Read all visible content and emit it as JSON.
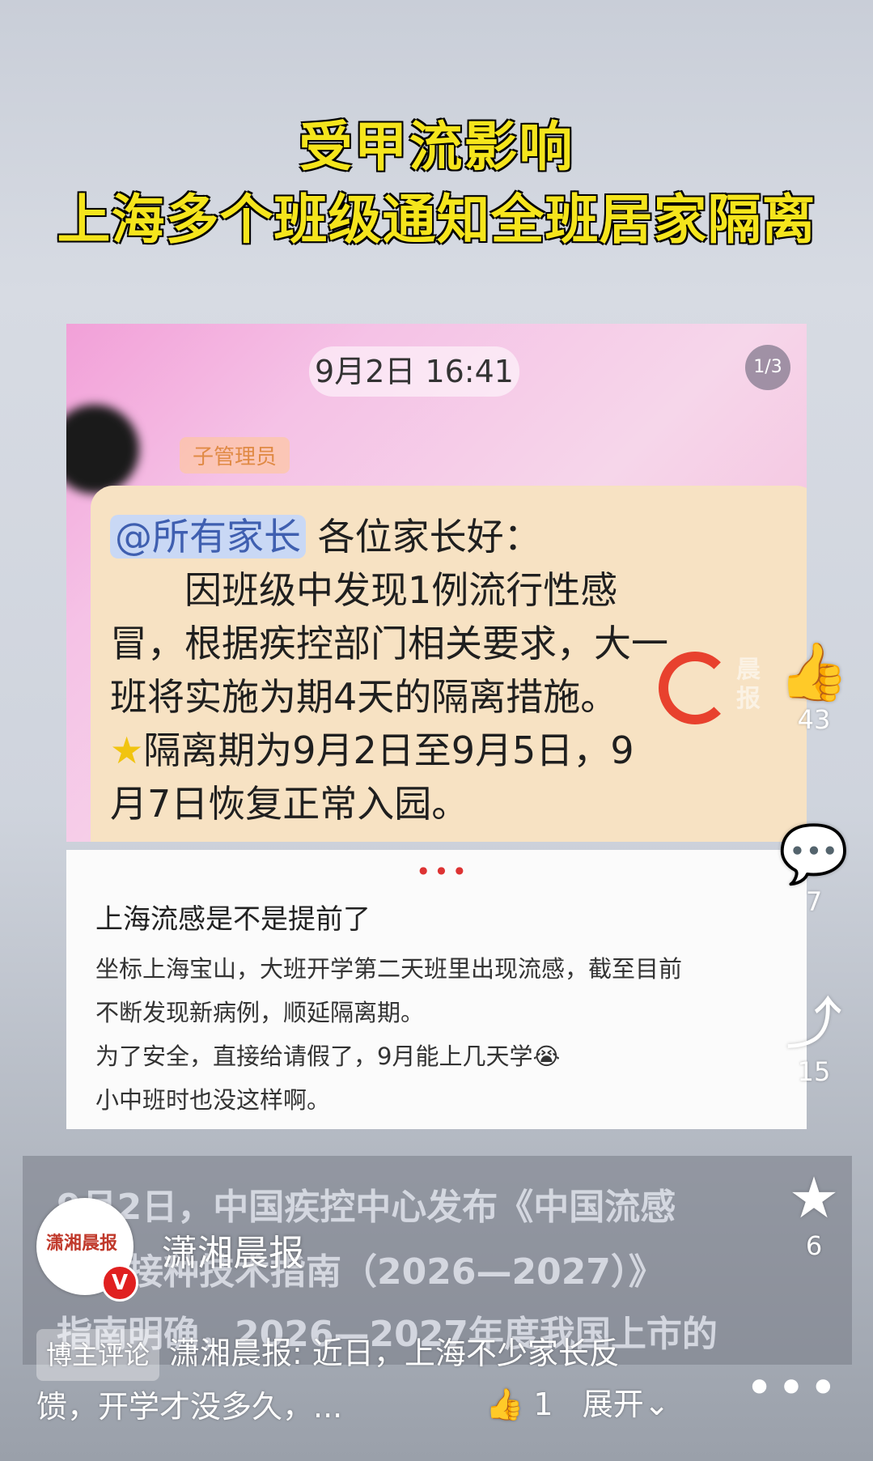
{
  "headline": {
    "line1": "受甲流影响",
    "line2": "上海多个班级通知全班居家隔离"
  },
  "chat_image": {
    "timestamp": "9月2日 16:41",
    "page_counter": "1/3",
    "admin_tag": "子管理员",
    "mention": "@所有家长",
    "greeting": "各位家长好：",
    "lines": [
      "因班级中发现1例流行性感",
      "冒，根据疾控部门相关要求，大一",
      "班将实施为期4天的隔离措施。",
      "隔离期为9月2日至9月5日，9",
      "月7日恢复正常入园。"
    ],
    "star_icon": "star-emoji"
  },
  "post": {
    "title": "上海流感是不是提前了",
    "body_lines": [
      "坐标上海宝山，大班开学第二天班里出现流感，截至目前",
      "不断发现新病例，顺延隔离期。",
      "为了安全，直接给请假了，9月能上几天学😭",
      "小中班时也没这样啊。"
    ]
  },
  "caption_lines": [
    "9月2日，中国疾控中心发布《中国流感",
    "预防接种技术指南（2026—2027）》",
    "指南明确，2026—2027年度我国上市的"
  ],
  "side_rail": {
    "like_count": "43",
    "comment_count": "7",
    "share_count": "15",
    "favorite_count": "6"
  },
  "author": {
    "name": "潇湘晨报",
    "logo_text": "潇湘晨报",
    "verified_badge": "V"
  },
  "comment": {
    "tag": "博主评论",
    "text": "潇湘晨报: 近日，上海不少家长反馈，开学才没多久，...",
    "like_count": "1",
    "expand_label": "展开"
  }
}
